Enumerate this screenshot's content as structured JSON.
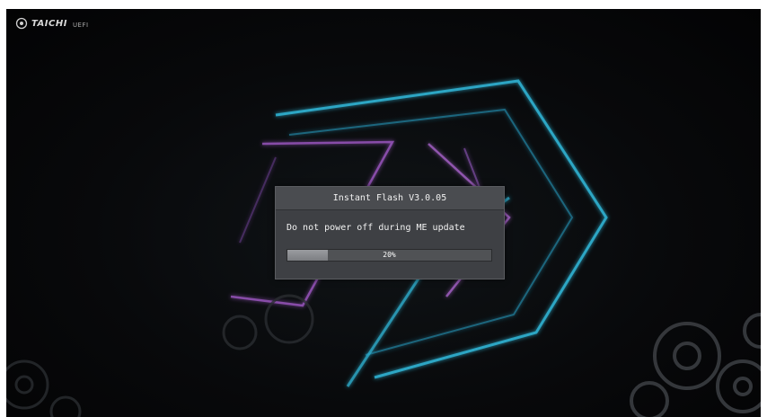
{
  "brand": {
    "name": "TAICHI",
    "sub": "UEFI"
  },
  "dialog": {
    "title": "Instant Flash  V3.0.05",
    "message": "Do not power off during ME update",
    "progress_label": "20%",
    "progress_fraction": 0.2
  },
  "colors": {
    "background": "#06070a",
    "cyan_glow": "#38c8e8",
    "purple_glow": "#b86ad8",
    "dialog_bg": "#3e4044",
    "progress_fill": "#8c8e92"
  },
  "icons": {
    "brand_logo": "taichi-gear-logo",
    "background_gears": "gears"
  }
}
